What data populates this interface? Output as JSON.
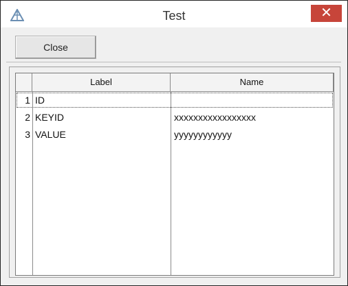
{
  "window": {
    "title": "Test",
    "close_glyph": "✕"
  },
  "toolbar": {
    "close_label": "Close"
  },
  "grid": {
    "headers": {
      "label": "Label",
      "name": "Name"
    },
    "rows": [
      {
        "index": "1",
        "label": "ID",
        "name": ""
      },
      {
        "index": "2",
        "label": "KEYID",
        "name": "xxxxxxxxxxxxxxxxx"
      },
      {
        "index": "3",
        "label": "VALUE",
        "name": "yyyyyyyyyyyy"
      }
    ]
  },
  "colors": {
    "close_button_bg": "#c7453a",
    "app_icon": "#6b8fb3"
  }
}
